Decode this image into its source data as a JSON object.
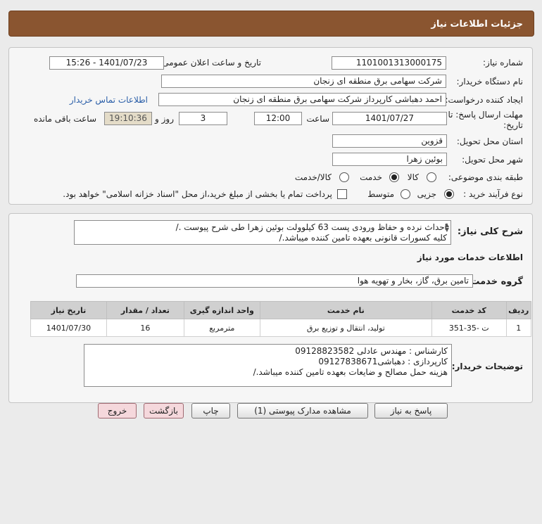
{
  "header": {
    "title": "جزئیات اطلاعات نیاز"
  },
  "form": {
    "need_number_label": "شماره نیاز:",
    "need_number": "1101001313000175",
    "announce_label": "تاریخ و ساعت اعلان عمومی:",
    "announce_value": "1401/07/23 - 15:26",
    "buyer_label": "نام دستگاه خریدار:",
    "buyer_value": "شرکت سهامی برق منطقه ای زنجان",
    "creator_label": "ایجاد کننده درخواست:",
    "creator_value": "احمد دهباشی کارپرداز شرکت سهامی برق منطقه ای زنجان",
    "contact_link": "اطلاعات تماس خریدار",
    "deadline_label_1": "مهلت ارسال پاسخ: تا",
    "deadline_label_2": "تاریخ:",
    "deadline_date": "1401/07/27",
    "time_label": "ساعت",
    "deadline_time": "12:00",
    "days_value": "3",
    "days_label": "روز و",
    "remaining_time": "19:10:36",
    "remaining_label": "ساعت باقی مانده",
    "province_label": "استان محل تحویل:",
    "province_value": "قزوین",
    "city_label": "شهر محل تحویل:",
    "city_value": "بوئین زهرا",
    "category_label": "طبقه بندی موضوعی:",
    "category_goods": "کالا",
    "category_service": "خدمت",
    "category_both": "کالا/خدمت",
    "process_label": "نوع فرآیند خرید :",
    "process_partial": "جزیی",
    "process_medium": "متوسط",
    "payment_note": "پرداخت تمام یا بخشی از مبلغ خرید،از محل \"اسناد خزانه اسلامی\" خواهد بود."
  },
  "description": {
    "label": "شرح کلی نیاز:",
    "line1": "احداث نرده و حفاظ ورودی پست  63 کیلوولت بوئین زهرا طی شرح پیوست ./",
    "line2": "کلیه کسورات قانونی بعهده تامین کننده میباشد./"
  },
  "services": {
    "section_title": "اطلاعات خدمات مورد نیاز",
    "group_label": "گروه خدمت:",
    "group_value": "تامین برق، گاز، بخار و تهویه هوا",
    "columns": [
      "ردیف",
      "کد خدمت",
      "نام خدمت",
      "واحد اندازه گیری",
      "تعداد / مقدار",
      "تاریخ نیاز"
    ],
    "rows": [
      [
        "1",
        "ت -35-351",
        "تولید، انتقال و توزیع برق",
        "مترمربع",
        "16",
        "1401/07/30"
      ]
    ]
  },
  "buyer_notes": {
    "label": "توضیحات خریدار:",
    "line1": "کارشناس : مهندس عادلی 09128823582",
    "line2": "کارپردازی : دهباشی09127838671",
    "line3": "هزینه حمل مصالح و ضایعات بعهده تامین کننده میباشد./"
  },
  "buttons": {
    "reply": "پاسخ به نیاز",
    "attachments": "مشاهده مدارک پیوستی (1)",
    "print": "چاپ",
    "back": "بازگشت",
    "exit": "خروج"
  }
}
